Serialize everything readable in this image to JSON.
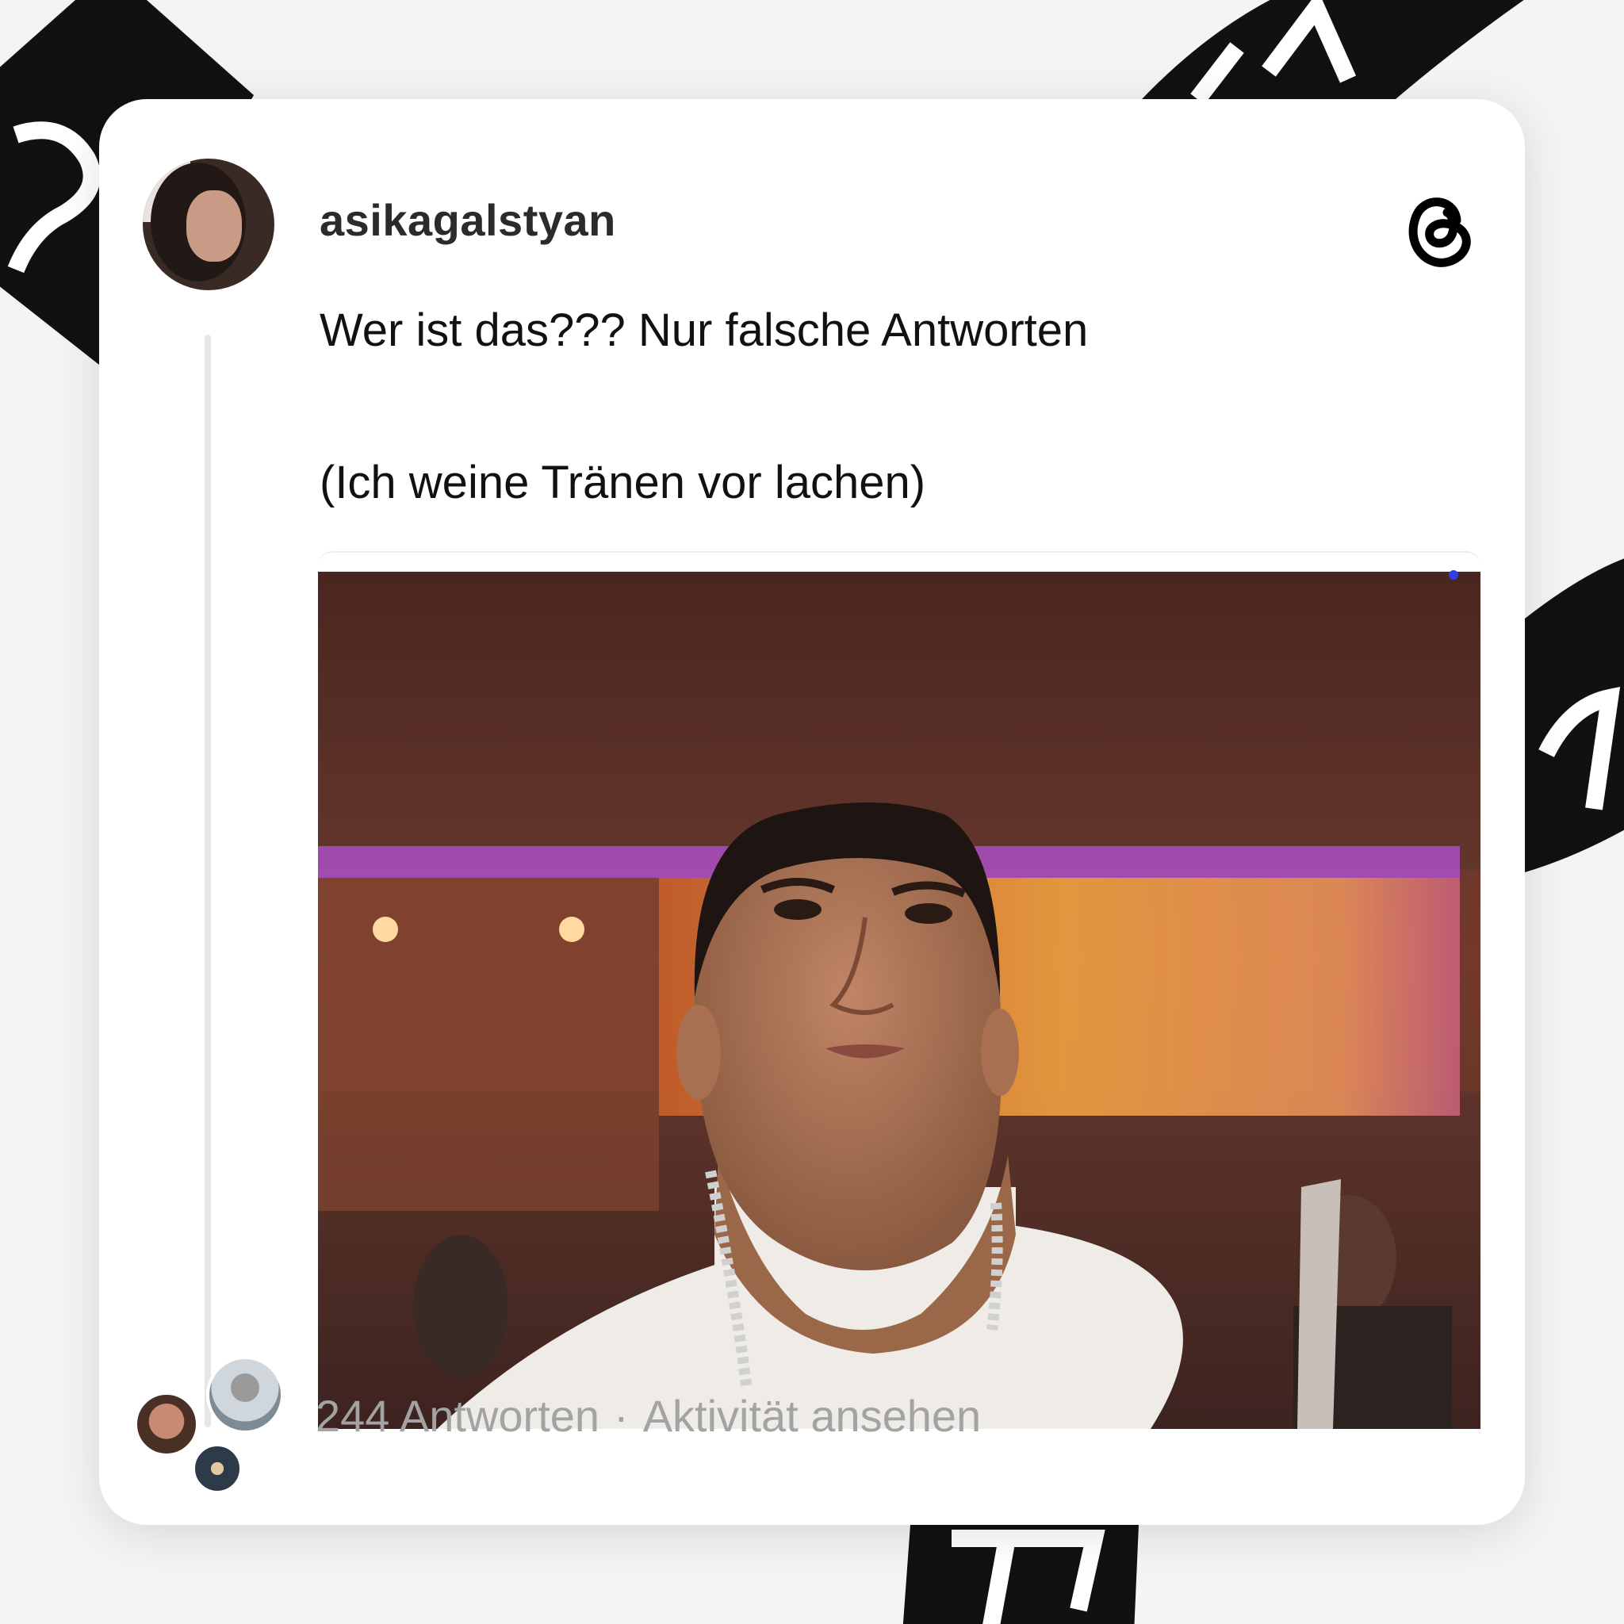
{
  "post": {
    "username": "asikagalstyan",
    "text_line1": "Wer ist das??? Nur falsche Antworten",
    "text_line2": "(Ich weine Tränen vor lachen)"
  },
  "footer": {
    "replies": "244 Antworten",
    "separator": "·",
    "activity_link": "Aktivität ansehen"
  },
  "colors": {
    "card_bg": "#ffffff",
    "text": "#111111",
    "muted": "#a3a3a3",
    "ribbon": "#111111"
  },
  "icons": [
    "threads-logo-icon"
  ]
}
